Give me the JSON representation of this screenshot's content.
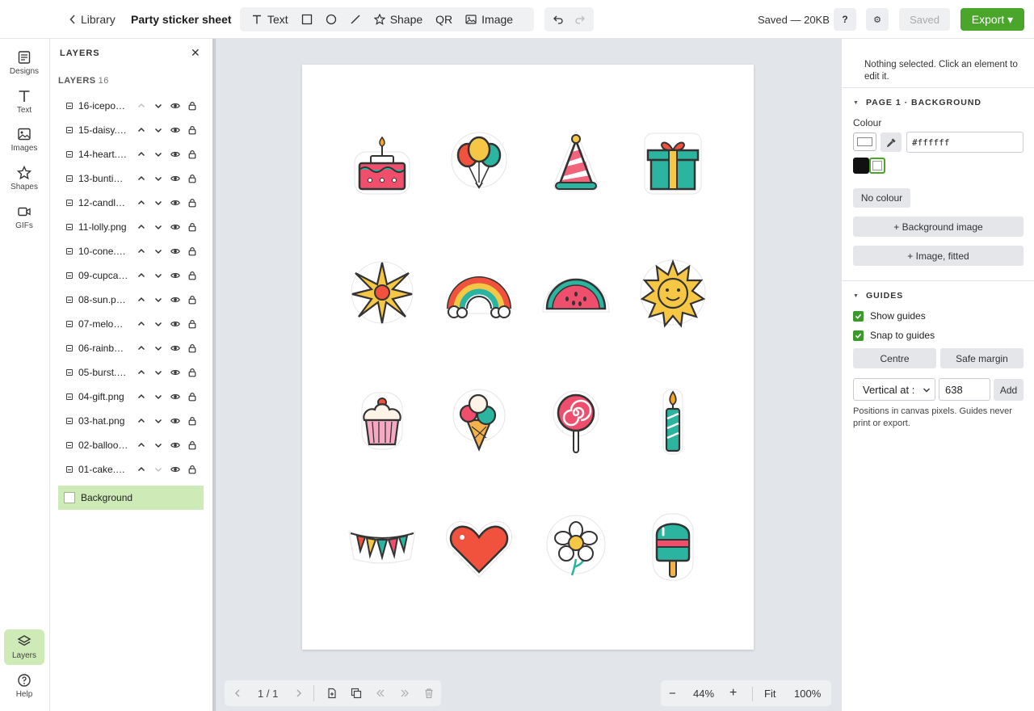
{
  "topbar": {
    "back_label": "Library",
    "doc_title": "Party sticker sheet",
    "tools": [
      "Text",
      "Shape",
      "QR",
      "Image"
    ],
    "saved_size": "Saved — 20KB",
    "help_label": "?",
    "settings_label": "⚙",
    "saved_button": "Saved",
    "export_label": "Export ▾"
  },
  "rail": {
    "items": [
      "Designs",
      "Text",
      "Images",
      "Shapes",
      "GIFs"
    ],
    "layers": "Layers",
    "help": "Help"
  },
  "layers_panel": {
    "title": "LAYERS",
    "close": "✕",
    "subtitle": "LAYERS",
    "count": "16",
    "layers": [
      "16-icepop…",
      "15-daisy.…",
      "14-heart.…",
      "13-buntin…",
      "12-candle…",
      "11-lolly.png",
      "10-cone.…",
      "09-cupca…",
      "08-sun.p…",
      "07-melon.…",
      "06-rainbo…",
      "05-burst.…",
      "04-gift.png",
      "03-hat.png",
      "02-balloo…",
      "01-cake.p…"
    ],
    "background_label": "Background"
  },
  "canvas": {
    "stickers": [
      "cake",
      "balloons",
      "party-hat",
      "gift",
      "burst",
      "rainbow",
      "watermelon",
      "sun",
      "cupcake",
      "ice-cream-cone",
      "lollipop",
      "candle",
      "bunting",
      "heart",
      "daisy",
      "ice-pop"
    ]
  },
  "bottombar": {
    "page_count": "1 / 1",
    "zoom": "44%",
    "fit": "Fit",
    "zoom_100": "100%",
    "minus": "−",
    "plus": "+"
  },
  "right_panel": {
    "hint": "Nothing selected. Click an element to edit it.",
    "bg_section": "PAGE 1 · BACKGROUND",
    "colour_label": "Colour",
    "hex_value": "#ffffff",
    "no_colour": "No colour",
    "bg_image": "+ Background image",
    "image_fitted": "+ Image, fitted",
    "guides_section": "GUIDES",
    "show_guides": "Show guides",
    "snap_guides": "Snap to guides",
    "centre": "Centre",
    "safe_margin": "Safe margin",
    "orientation": "Vertical at :",
    "guide_value": "638",
    "add": "Add",
    "note": "Positions in canvas pixels. Guides never print or export."
  },
  "colors": {
    "accent_green": "#4aa52b",
    "active_bg": "#cdeab7",
    "canvas_bg": "#e2e5ea"
  }
}
